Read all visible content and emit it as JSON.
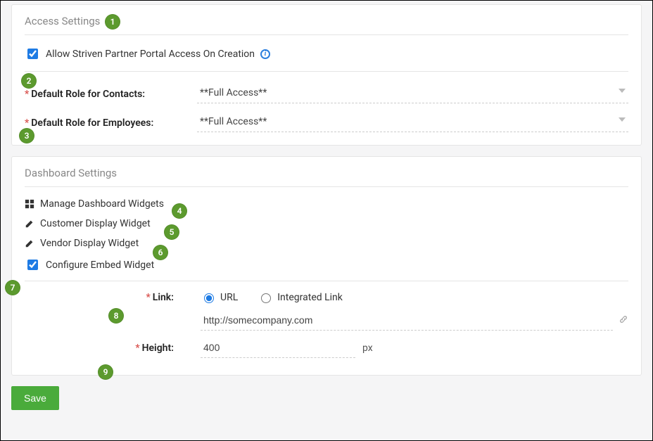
{
  "access_settings": {
    "title": "Access Settings",
    "allow_label": "Allow Striven Partner Portal Access On Creation",
    "allow_checked": true,
    "contacts_label": "Default Role for Contacts:",
    "contacts_value": "**Full Access**",
    "employees_label": "Default Role for Employees:",
    "employees_value": "**Full Access**"
  },
  "dashboard_settings": {
    "title": "Dashboard Settings",
    "manage_label": "Manage Dashboard Widgets",
    "customer_label": "Customer Display Widget",
    "vendor_label": "Vendor Display Widget",
    "configure_label": "Configure Embed Widget",
    "configure_checked": true,
    "link_label": "Link:",
    "radio_url": "URL",
    "radio_integrated": "Integrated Link",
    "link_value": "http://somecompany.com",
    "height_label": "Height:",
    "height_value": "400",
    "height_unit": "px"
  },
  "actions": {
    "save": "Save"
  },
  "badges": [
    "1",
    "2",
    "3",
    "4",
    "5",
    "6",
    "7",
    "8",
    "9"
  ]
}
